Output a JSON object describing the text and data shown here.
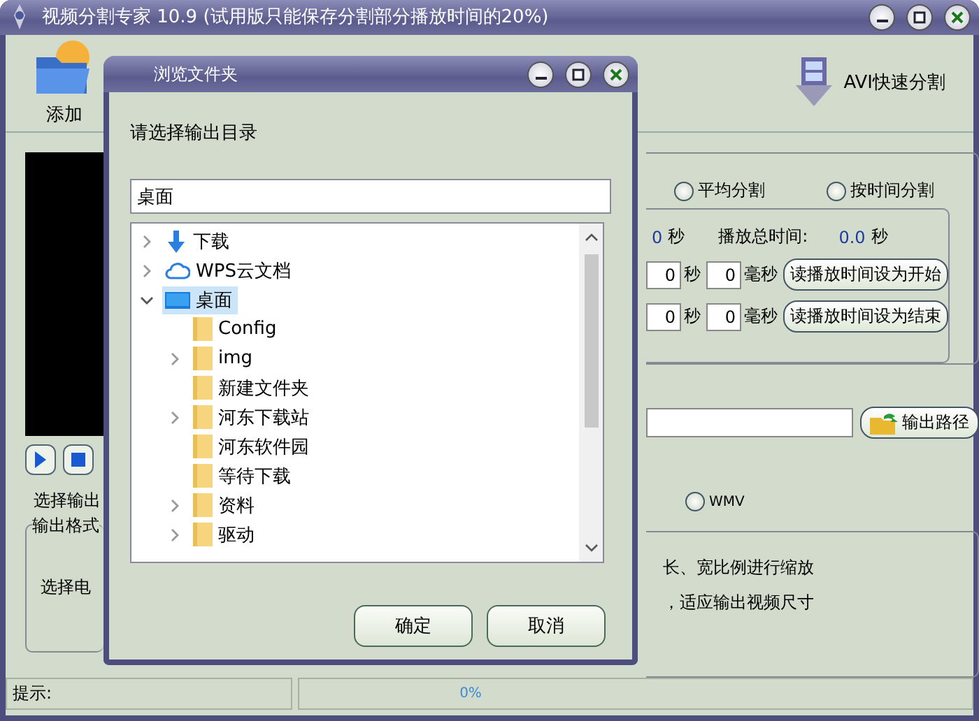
{
  "window": {
    "title": "视频分割专家 10.9 (试用版只能保存分割部分播放时间的20%)"
  },
  "toolbar": [
    {
      "label": "添加",
      "kind": "add"
    },
    {
      "label": "AVI快速分割",
      "kind": "avi"
    }
  ],
  "left_panel": {
    "output_label": "选择输出",
    "format_group": "输出格式",
    "format_text": "选择电"
  },
  "split_mode": [
    {
      "label": "平均分割",
      "selected": false
    },
    {
      "label": "按时间分割",
      "selected": false
    }
  ],
  "time_info": {
    "part_value": "0",
    "part_unit": "秒",
    "total_label": "播放总时间:",
    "total_value": "0.0",
    "total_unit": "秒"
  },
  "time_rows": [
    {
      "seconds": "0",
      "sec_unit": "秒",
      "ms": "0",
      "ms_unit": "毫秒",
      "button": "读播放时间设为开始"
    },
    {
      "seconds": "0",
      "sec_unit": "秒",
      "ms": "0",
      "ms_unit": "毫秒",
      "button": "读播放时间设为结束"
    }
  ],
  "output_path": {
    "button": "输出路径"
  },
  "formats": [
    {
      "label": "WMV",
      "selected": false
    }
  ],
  "scale_notes": [
    "长、宽比例进行缩放",
    "，适应输出视频尺寸"
  ],
  "status": {
    "label": "提示:",
    "progress": "0%"
  },
  "dialog": {
    "title": "浏览文件夹",
    "prompt": "请选择输出目录",
    "path": "桌面",
    "tree": [
      {
        "label": "下载",
        "kind": "download",
        "expandable": true,
        "expanded": false,
        "selected": false
      },
      {
        "label": "WPS云文档",
        "kind": "cloud",
        "expandable": true,
        "expanded": false,
        "selected": false
      },
      {
        "label": "桌面",
        "kind": "desktop",
        "expandable": true,
        "expanded": true,
        "selected": true,
        "children": [
          {
            "label": "Config",
            "kind": "folder",
            "expandable": false,
            "expanded": false,
            "selected": false
          },
          {
            "label": "img",
            "kind": "folder",
            "expandable": true,
            "expanded": false,
            "selected": false
          },
          {
            "label": "新建文件夹",
            "kind": "folder",
            "expandable": false,
            "expanded": false,
            "selected": false
          },
          {
            "label": "河东下载站",
            "kind": "folder",
            "expandable": true,
            "expanded": false,
            "selected": false
          },
          {
            "label": "河东软件园",
            "kind": "folder",
            "expandable": false,
            "expanded": false,
            "selected": false
          },
          {
            "label": "等待下载",
            "kind": "folder",
            "expandable": false,
            "expanded": false,
            "selected": false
          },
          {
            "label": "资料",
            "kind": "folder",
            "expandable": true,
            "expanded": false,
            "selected": false
          },
          {
            "label": "驱动",
            "kind": "folder",
            "expandable": true,
            "expanded": false,
            "selected": false
          }
        ]
      }
    ],
    "buttons": [
      "确定",
      "取消"
    ]
  }
}
